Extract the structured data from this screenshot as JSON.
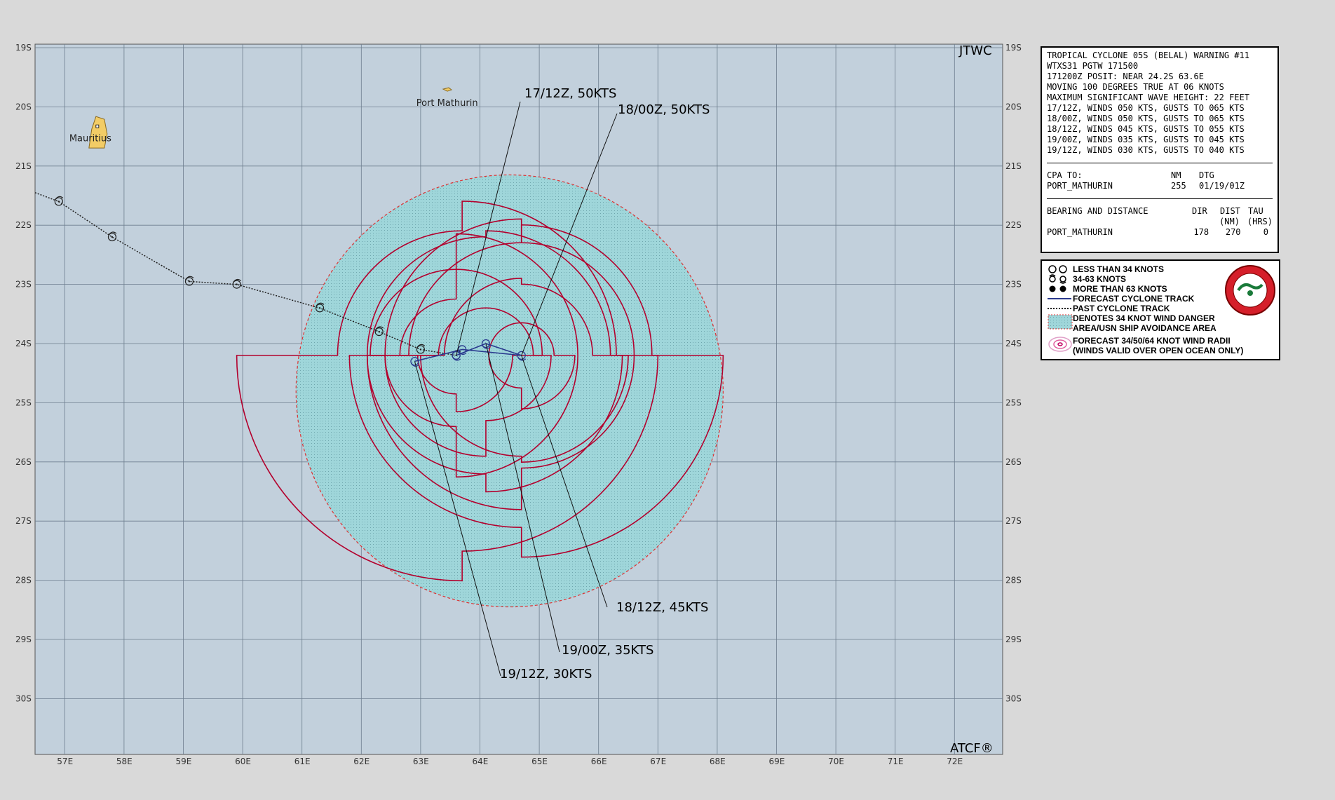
{
  "map": {
    "corner_top": "JTWC",
    "corner_bottom": "ATCF®",
    "lat_labels": [
      "19S",
      "20S",
      "21S",
      "22S",
      "23S",
      "24S",
      "25S",
      "26S",
      "27S",
      "28S",
      "29S",
      "30S"
    ],
    "lon_labels": [
      "57E",
      "58E",
      "59E",
      "60E",
      "61E",
      "62E",
      "63E",
      "64E",
      "65E",
      "66E",
      "67E",
      "68E",
      "69E",
      "70E",
      "71E",
      "72E"
    ],
    "places": [
      {
        "name": "Port Mathurin",
        "lon": 63.4,
        "lat": -19.7
      },
      {
        "name": "Mauritius",
        "lon": 57.55,
        "lat": -20.3
      }
    ],
    "forecast_labels": [
      "17/12Z,  50KTS",
      "18/00Z,  50KTS",
      "18/12Z,  45KTS",
      "19/00Z,  35KTS",
      "19/12Z,  30KTS"
    ],
    "past_track": [
      {
        "lon": 56.5,
        "lat": -21.45
      },
      {
        "lon": 56.9,
        "lat": -21.6
      },
      {
        "lon": 57.8,
        "lat": -22.2
      },
      {
        "lon": 59.1,
        "lat": -22.95
      },
      {
        "lon": 59.9,
        "lat": -23.0
      },
      {
        "lon": 61.3,
        "lat": -23.4
      },
      {
        "lon": 62.3,
        "lat": -23.8
      },
      {
        "lon": 63.0,
        "lat": -24.1
      },
      {
        "lon": 63.6,
        "lat": -24.2
      }
    ],
    "forecast_track": [
      {
        "lon": 63.6,
        "lat": -24.2
      },
      {
        "lon": 64.1,
        "lat": -24.0
      },
      {
        "lon": 64.7,
        "lat": -24.2
      },
      {
        "lon": 63.7,
        "lat": -24.1
      },
      {
        "lon": 62.9,
        "lat": -24.3
      }
    ],
    "danger_area": {
      "center_lon": 64.5,
      "center_lat": -24.8,
      "radius_lon": 3.6,
      "radius_lat": 3.65
    },
    "colors": {
      "ocean": "#c2d0dc",
      "danger": "#9fd6da",
      "radii": "#b3002d",
      "track": "#2b3a8f",
      "land": "#f2cc66"
    }
  },
  "warning": {
    "lines": [
      "TROPICAL CYCLONE 05S (BELAL) WARNING #11",
      "WTXS31 PGTW 171500",
      "171200Z POSIT: NEAR 24.2S 63.6E",
      "MOVING 100 DEGREES TRUE AT 06 KNOTS",
      "MAXIMUM SIGNIFICANT WAVE HEIGHT: 22 FEET",
      "17/12Z, WINDS 050 KTS, GUSTS TO 065 KTS",
      "18/00Z, WINDS 050 KTS, GUSTS TO 065 KTS",
      "18/12Z, WINDS 045 KTS, GUSTS TO 055 KTS",
      "19/00Z, WINDS 035 KTS, GUSTS TO 045 KTS",
      "19/12Z, WINDS 030 KTS, GUSTS TO 040 KTS"
    ],
    "cpa": {
      "header_a": "CPA TO:",
      "header_b": "NM",
      "header_c": "DTG",
      "place": "PORT_MATHURIN",
      "nm": "255",
      "dtg": "01/19/01Z"
    },
    "bearing": {
      "header_a": "BEARING AND DISTANCE",
      "h_dir": "DIR",
      "h_dist": "DIST",
      "h_tau": "TAU",
      "h_dist2": "(NM)",
      "h_tau2": "(HRS)",
      "place": "PORT_MATHURIN",
      "dir": "178",
      "dist": "270",
      "tau": "0"
    }
  },
  "legend": {
    "items": [
      "LESS THAN 34 KNOTS",
      "34-63 KNOTS",
      "MORE THAN 63 KNOTS",
      "FORECAST CYCLONE TRACK",
      "PAST CYCLONE TRACK",
      "DENOTES 34 KNOT WIND DANGER",
      "AREA/USN SHIP AVOIDANCE AREA",
      "FORECAST 34/50/64 KNOT WIND RADII",
      "(WINDS VALID OVER OPEN OCEAN ONLY)"
    ]
  }
}
